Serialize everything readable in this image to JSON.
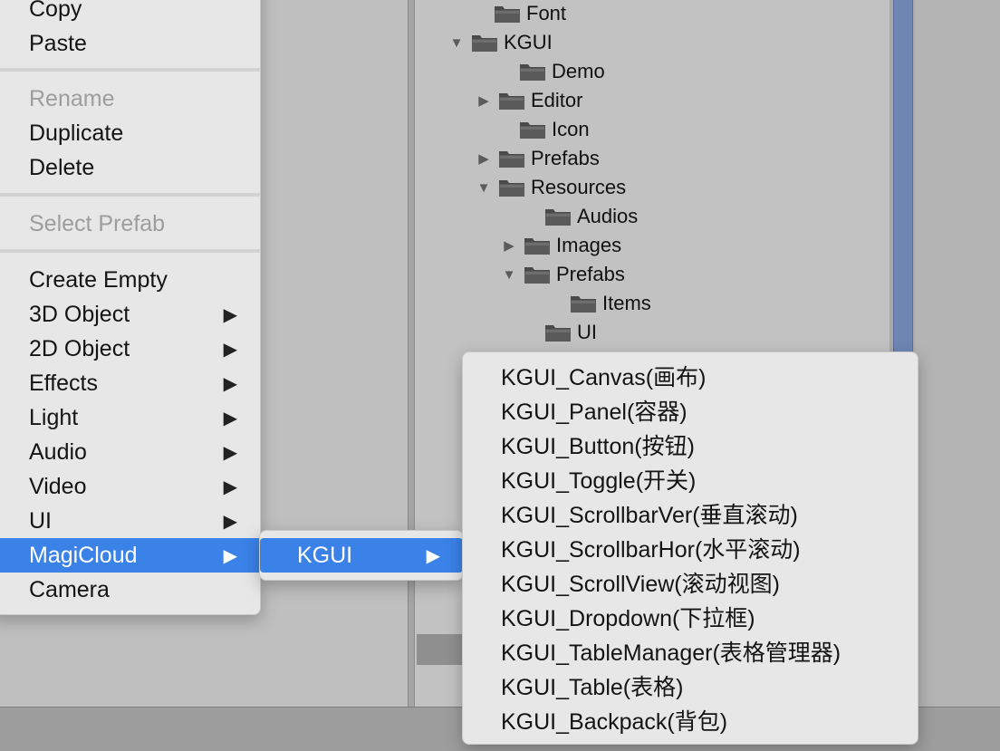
{
  "project_tree": [
    {
      "label": "Font",
      "expander": "none"
    },
    {
      "label": "KGUI",
      "expander": "expanded"
    },
    {
      "label": "Demo",
      "expander": "none"
    },
    {
      "label": "Editor",
      "expander": "collapsed"
    },
    {
      "label": "Icon",
      "expander": "none"
    },
    {
      "label": "Prefabs",
      "expander": "collapsed"
    },
    {
      "label": "Resources",
      "expander": "expanded"
    },
    {
      "label": "Audios",
      "expander": "none"
    },
    {
      "label": "Images",
      "expander": "collapsed"
    },
    {
      "label": "Prefabs",
      "expander": "expanded"
    },
    {
      "label": "Items",
      "expander": "none"
    },
    {
      "label": "UI",
      "expander": "none"
    }
  ],
  "context_menu": {
    "copy": "Copy",
    "paste": "Paste",
    "rename": "Rename",
    "duplicate": "Duplicate",
    "delete": "Delete",
    "select_prefab": "Select Prefab",
    "create_empty": "Create Empty",
    "object_3d": "3D Object",
    "object_2d": "2D Object",
    "effects": "Effects",
    "light": "Light",
    "audio": "Audio",
    "video": "Video",
    "ui": "UI",
    "magicloud": "MagiCloud",
    "camera": "Camera",
    "submenu_arrow": "▶"
  },
  "magicloud_submenu": {
    "kgui": "KGUI"
  },
  "kgui_submenu": [
    "KGUI_Canvas(画布)",
    "KGUI_Panel(容器)",
    "KGUI_Button(按钮)",
    "KGUI_Toggle(开关)",
    "KGUI_ScrollbarVer(垂直滚动)",
    "KGUI_ScrollbarHor(水平滚动)",
    "KGUI_ScrollView(滚动视图)",
    "KGUI_Dropdown(下拉框)",
    "KGUI_TableManager(表格管理器)",
    "KGUI_Table(表格)",
    "KGUI_Backpack(背包)"
  ],
  "colors": {
    "highlight": "#3a82e8",
    "menu_bg": "#e7e7e7",
    "folder": "#4a4a4a"
  }
}
